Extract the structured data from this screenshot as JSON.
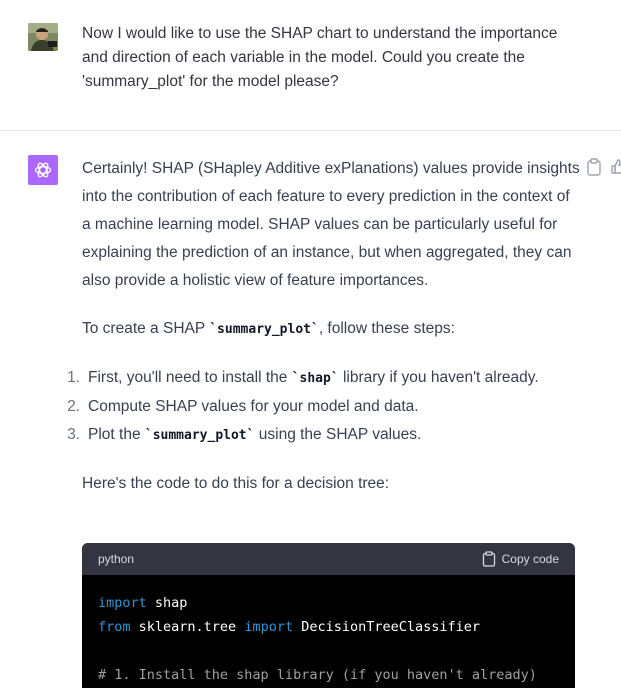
{
  "user_message": {
    "text": "Now I would like to use the SHAP chart to understand the importance and direction of each variable in the model. Could you create the 'summary_plot' for the model please?"
  },
  "assistant_message": {
    "intro": "Certainly! SHAP (SHapley Additive exPlanations) values provide insights into the contribution of each feature to every prediction in the context of a machine learning model. SHAP values can be particularly useful for explaining the prediction of an instance, but when aggregated, they can also provide a holistic view of feature importances.",
    "create_prefix": "To create a SHAP ",
    "create_code": "`summary_plot`",
    "create_suffix": ", follow these steps:",
    "steps": [
      {
        "num": "1.",
        "before": "First, you'll need to install the ",
        "code": "`shap`",
        "after": " library if you haven't already."
      },
      {
        "num": "2.",
        "before": "Compute SHAP values for your model and data.",
        "code": "",
        "after": ""
      },
      {
        "num": "3.",
        "before": "Plot the ",
        "code": "`summary_plot`",
        "after": " using the SHAP values."
      }
    ],
    "code_intro": "Here's the code to do this for a decision tree:"
  },
  "code_block": {
    "language": "python",
    "copy_label": "Copy code",
    "lines": {
      "l1_kw": "import",
      "l1_rest": " shap",
      "l2_kw1": "from",
      "l2_mid": " sklearn.tree ",
      "l2_kw2": "import",
      "l2_rest": " DecisionTreeClassifier",
      "l4_comment": "# 1. Install the shap library (if you haven't already)"
    }
  },
  "colors": {
    "gpt_avatar": "#ab68ff",
    "code_bg": "#000000",
    "code_header_bg": "#343541",
    "keyword": "#2e95d3"
  },
  "icons": [
    "user-avatar",
    "openai-logo-icon",
    "clipboard-icon",
    "thumbs-up-icon"
  ]
}
